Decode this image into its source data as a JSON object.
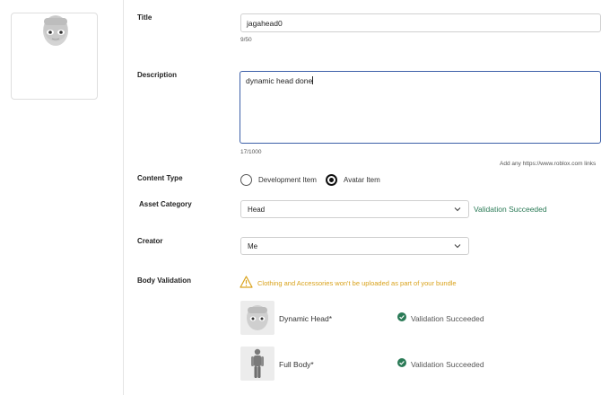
{
  "form": {
    "title_label": "Title",
    "title_value": "jagahead0",
    "title_counter": "9/50",
    "description_label": "Description",
    "description_value": "dynamic head done",
    "description_counter": "17/1000",
    "links_hint": "Add any https://www.roblox.com links",
    "content_type_label": "Content Type",
    "content_type_options": [
      {
        "label": "Development Item",
        "selected": false
      },
      {
        "label": "Avatar Item",
        "selected": true
      }
    ],
    "asset_category_label": "Asset Category",
    "asset_category_value": "Head",
    "asset_category_status": "Validation Succeeded",
    "creator_label": "Creator",
    "creator_value": "Me",
    "body_validation_label": "Body Validation",
    "warning_text": "Clothing and Accessories won't be uploaded as part of your bundle",
    "validation_items": [
      {
        "name": "Dynamic Head*",
        "status": "Validation Succeeded"
      },
      {
        "name": "Full Body*",
        "status": "Validation Succeeded"
      }
    ]
  },
  "colors": {
    "accent_border": "#3c5fa8",
    "success": "#2a7a56",
    "warning": "#d9a21b"
  }
}
